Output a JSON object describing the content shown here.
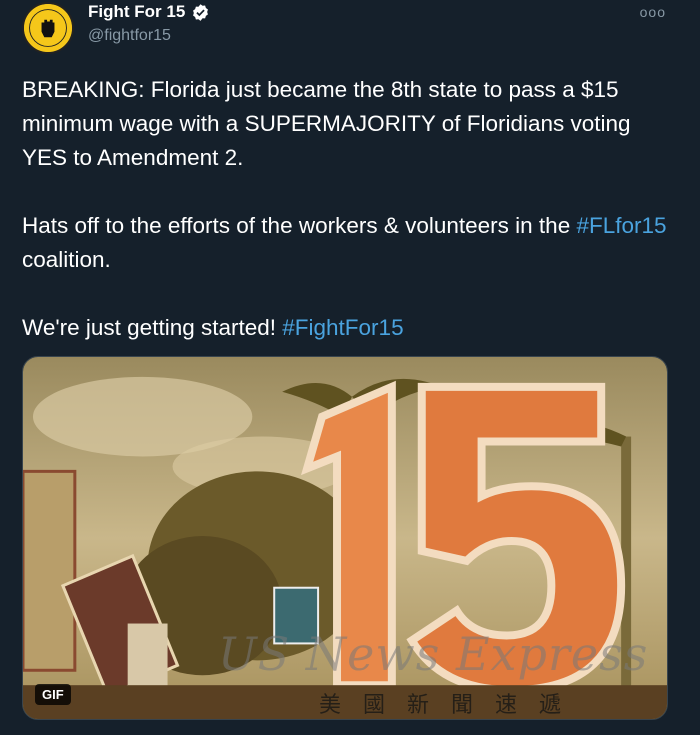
{
  "author": {
    "display_name": "Fight For 15",
    "handle": "@fightfor15",
    "verified": true,
    "avatar_icon": "raised-fist-logo"
  },
  "more_label": "ooo",
  "tweet": {
    "paragraph1": "BREAKING: Florida just became the 8th state to pass a $15 minimum wage with a SUPERMAJORITY of Floridians voting YES to Amendment 2.",
    "paragraph2_before": "Hats off to the efforts of the workers & volunteers in the ",
    "paragraph2_hashtag": "#FLfor15",
    "paragraph2_after": " coalition.",
    "paragraph3_before": "We're just getting started! ",
    "paragraph3_hashtag": "#FightFor15"
  },
  "media": {
    "badge": "GIF",
    "watermark": "US News Express",
    "watermark_sub": "美國新聞速遞"
  },
  "colors": {
    "background": "#15202b",
    "hashtag": "#4aa3df",
    "secondary_text": "#8899a6"
  }
}
